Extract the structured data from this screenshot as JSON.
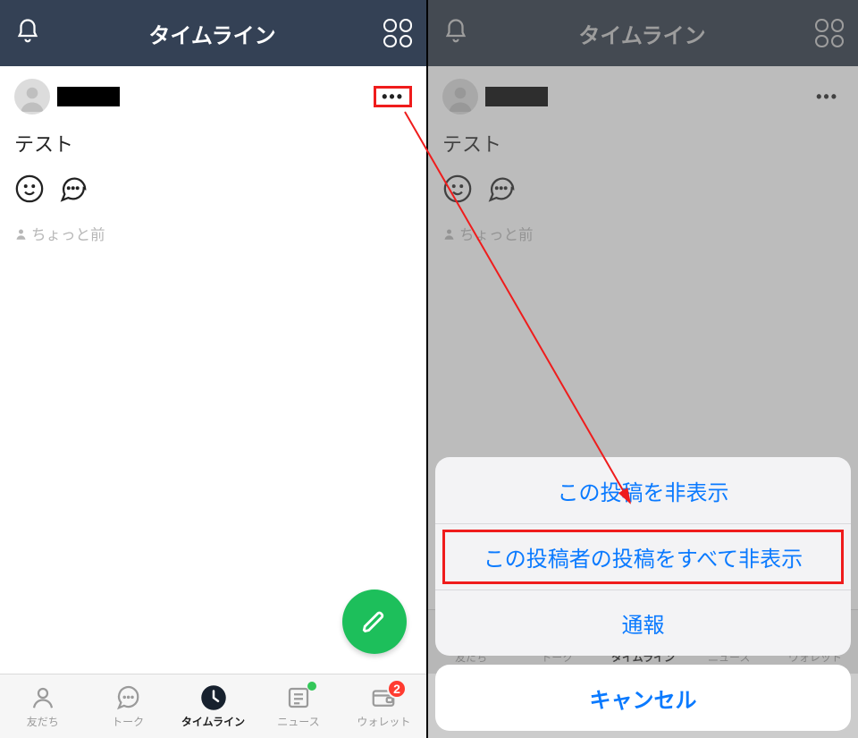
{
  "header": {
    "title": "タイムライン"
  },
  "post": {
    "text": "テスト",
    "ago": "ちょっと前"
  },
  "tabs": {
    "friends": "友だち",
    "talk": "トーク",
    "timeline": "タイムライン",
    "news": "ニュース",
    "wallet": "ウォレット",
    "wallet_badge": "2"
  },
  "sheet": {
    "hide_post": "この投稿を非表示",
    "hide_user": "この投稿者の投稿をすべて非表示",
    "report": "通報",
    "cancel": "キャンセル"
  }
}
